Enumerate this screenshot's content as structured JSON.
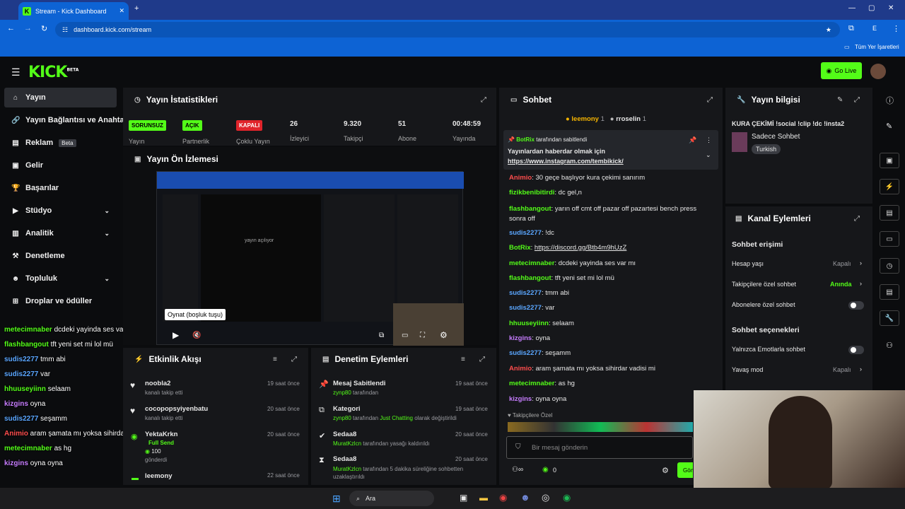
{
  "browser": {
    "tab_title": "Stream - Kick Dashboard",
    "url": "dashboard.kick.com/stream",
    "bookmarks_label": "Tüm Yer İşaretleri",
    "profile_initial": "E"
  },
  "header": {
    "logo": "KICK",
    "logo_beta": "BETA",
    "go_live": "Go Live"
  },
  "sidebar": {
    "items": [
      {
        "label": "Yayın",
        "icon": "home-icon"
      },
      {
        "label": "Yayın Bağlantısı ve Anahtar",
        "icon": "link-icon"
      },
      {
        "label": "Reklam",
        "icon": "ad-icon",
        "badge": "Beta"
      },
      {
        "label": "Gelir",
        "icon": "wallet-icon"
      },
      {
        "label": "Başarılar",
        "icon": "trophy-icon"
      },
      {
        "label": "Stüdyo",
        "icon": "studio-icon"
      },
      {
        "label": "Analitik",
        "icon": "analytics-icon"
      },
      {
        "label": "Denetleme",
        "icon": "hammer-icon"
      },
      {
        "label": "Topluluk",
        "icon": "community-icon"
      },
      {
        "label": "Droplar ve ödüller",
        "icon": "gift-icon"
      }
    ]
  },
  "overlay_chat": [
    {
      "user": "metecimnaber",
      "msg": "dcdeki yayinda ses var mı",
      "color": "#53fc18"
    },
    {
      "user": "flashbangout",
      "msg": "tft yeni set mi lol mü",
      "color": "#53fc18"
    },
    {
      "user": "sudis2277",
      "msg": "tmm abi",
      "color": "#5aa6ff"
    },
    {
      "user": "sudis2277",
      "msg": "var",
      "color": "#5aa6ff"
    },
    {
      "user": "hhuuseyiinn",
      "msg": "selaam",
      "color": "#53fc18"
    },
    {
      "user": "kizgins",
      "msg": "oyna",
      "color": "#c77dff"
    },
    {
      "user": "sudis2277",
      "msg": "seşamm",
      "color": "#5aa6ff"
    },
    {
      "user": "Animio",
      "msg": "aram şamata mı yoksa sihirdar vadisi mi",
      "color": "#ff4d4d"
    },
    {
      "user": "metecimnaber",
      "msg": "as hg",
      "color": "#53fc18"
    },
    {
      "user": "kizgins",
      "msg": "oyna oyna",
      "color": "#c77dff"
    }
  ],
  "stats": {
    "title": "Yayın İstatistikleri",
    "items": [
      {
        "value": "SORUNSUZ",
        "label": "Yayın",
        "badge": true,
        "color": "#53fc18"
      },
      {
        "value": "AÇIK",
        "label": "Partnerlik",
        "badge": true,
        "color": "#53fc18"
      },
      {
        "value": "KAPALI",
        "label": "Çoklu Yayın",
        "badge": true,
        "color": "#e0242b"
      },
      {
        "value": "26",
        "label": "İzleyici"
      },
      {
        "value": "9.320",
        "label": "Takipçi"
      },
      {
        "value": "51",
        "label": "Abone"
      },
      {
        "value": "00:48:59",
        "label": "Yayında"
      }
    ]
  },
  "preview": {
    "title": "Yayın Ön İzlemesi",
    "tooltip": "Oynat (boşluk tuşu)",
    "inner_text": "yayın açılıyor"
  },
  "activity": {
    "title": "Etkinlik Akışı",
    "items": [
      {
        "name": "noobla2",
        "sub": "kanalı takip etti",
        "time": "19 saat önce"
      },
      {
        "name": "cocopopsyiyenbatu",
        "sub": "kanalı takip etti",
        "time": "20 saat önce"
      },
      {
        "name": "YektaKrkn",
        "sub": "Full Send",
        "amount": "100",
        "sub2": "gönderdi",
        "time": "20 saat önce"
      },
      {
        "name": "leemony",
        "sub": "",
        "time": "22 saat önce"
      }
    ]
  },
  "moderation": {
    "title": "Denetim Eylemleri",
    "items": [
      {
        "name": "Mesaj Sabitlendi",
        "user": "zynp80",
        "rest": "tarafından",
        "time": "19 saat önce"
      },
      {
        "name": "Kategori",
        "user": "zynp80",
        "rest": "tarafından",
        "highlight": "Just Chatting",
        "rest2": "olarak değiştirildi",
        "time": "19 saat önce"
      },
      {
        "name": "Sedaa8",
        "user": "MuratKzlcn",
        "rest": "tarafından yasağı kaldırıldı",
        "time": "20 saat önce"
      },
      {
        "name": "Sedaa8",
        "user": "MuratKzlcn",
        "rest": "tarafından 5 dakika süreliğine sohbetten uzaklaştırıldı",
        "time": "20 saat önce"
      }
    ]
  },
  "chat": {
    "title": "Sohbet",
    "top_users": [
      {
        "name": "leemony",
        "count": "1"
      },
      {
        "name": "rroselin",
        "count": "1"
      }
    ],
    "pinned": {
      "by": "BotRix",
      "by_suffix": "tarafından sabitlendi",
      "text": "Yayınlardan haberdar olmak için",
      "link": "https://www.instagram.com/tembikick/"
    },
    "messages": [
      {
        "user": "Animio",
        "msg": "30 geçe başlıyor kura çekimi sanırım",
        "color": "#ff4d4d"
      },
      {
        "user": "fizikbenibitirdi",
        "msg": "dc gel,n",
        "color": "#53fc18"
      },
      {
        "user": "flashbangout",
        "msg": "yarın off cmt off pazar off pazartesi",
        "msg2": "bench press sonra off",
        "color": "#53fc18"
      },
      {
        "user": "sudis2277",
        "msg": "!dc",
        "color": "#5aa6ff"
      },
      {
        "user": "BotRix",
        "msg": "https://discord.gg/Btb4m9hUzZ",
        "color": "#53fc18",
        "link": true
      },
      {
        "user": "metecimnaber",
        "msg": "dcdeki yayinda ses var mı",
        "color": "#53fc18"
      },
      {
        "user": "flashbangout",
        "msg": "tft yeni set mi lol mü",
        "color": "#53fc18"
      },
      {
        "user": "sudis2277",
        "msg": "tmm abi",
        "color": "#5aa6ff"
      },
      {
        "user": "sudis2277",
        "msg": "var",
        "color": "#5aa6ff"
      },
      {
        "user": "hhuuseyiinn",
        "msg": "selaam",
        "color": "#53fc18"
      },
      {
        "user": "kizgins",
        "msg": "oyna",
        "color": "#c77dff"
      },
      {
        "user": "sudis2277",
        "msg": "seşamm",
        "color": "#5aa6ff"
      },
      {
        "user": "Animio",
        "msg": "aram şamata mı yoksa sihirdar vadisi mi",
        "color": "#ff4d4d"
      },
      {
        "user": "metecimnaber",
        "msg": "as hg",
        "color": "#53fc18"
      },
      {
        "user": "kizgins",
        "msg": "oyna oyna",
        "color": "#c77dff"
      }
    ],
    "follower_only_label": "Takipçilere Özel",
    "input_placeholder": "Bir mesaj gönderin",
    "count": "0",
    "send": "Gönder"
  },
  "stream_info": {
    "title": "Yayın bilgisi",
    "stream_title": "KURA ÇEKİMİ !social !clip !dc !insta2",
    "category": "Sadece Sohbet",
    "language": "Turkish"
  },
  "channel_actions": {
    "title": "Kanal Eylemleri",
    "chat_access": "Sohbet erişimi",
    "rows": [
      {
        "label": "Hesap yaşı",
        "value": "Kapalı",
        "type": "chevron"
      },
      {
        "label": "Takipçilere özel sohbet",
        "value": "Anında",
        "type": "chevron",
        "green": true
      },
      {
        "label": "Abonelere özel sohbet",
        "type": "toggle"
      }
    ],
    "chat_options": "Sohbet seçenekleri",
    "rows2": [
      {
        "label": "Yalnızca Emotlarla sohbet",
        "type": "toggle"
      },
      {
        "label": "Yavaş mod",
        "value": "Kapalı",
        "type": "chevron"
      }
    ]
  },
  "taskbar": {
    "search": "Ara"
  }
}
